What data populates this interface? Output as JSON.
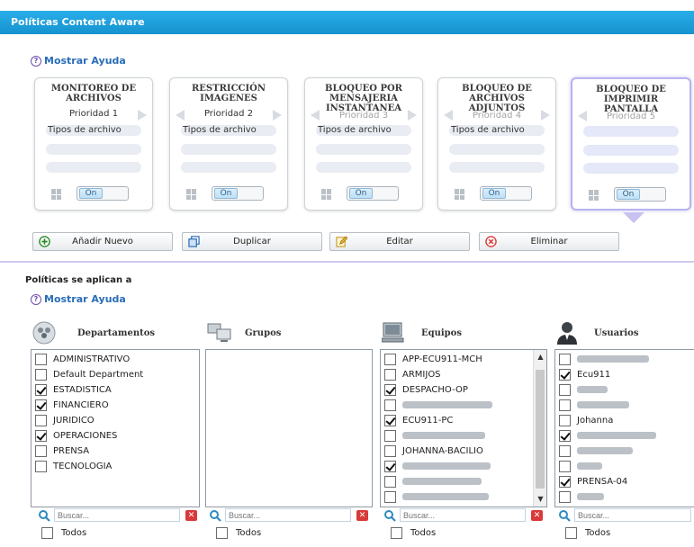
{
  "window": {
    "title": "Políticas Content Aware"
  },
  "help": {
    "label": "Mostrar Ayuda"
  },
  "cards": [
    {
      "title_lines": [
        "MONITOREO DE",
        "ARCHIVOS"
      ],
      "priority": "Prioridad 1",
      "file_types": "Tipos de archivo",
      "toggle": "On",
      "active": false
    },
    {
      "title_lines": [
        "RESTRICCIÓN",
        "IMAGENES"
      ],
      "priority": "Prioridad 2",
      "file_types": "Tipos de archivo",
      "toggle": "On",
      "active": false
    },
    {
      "title_lines": [
        "BLOQUEO POR",
        "MENSAJERIA",
        "INSTANTANEA"
      ],
      "priority": "Prioridad 3",
      "file_types": "Tipos de archivo",
      "toggle": "On",
      "active": false
    },
    {
      "title_lines": [
        "BLOQUEO DE",
        "ARCHIVOS",
        "ADJUNTOS"
      ],
      "priority": "Prioridad 4",
      "file_types": "Tipos de archivo",
      "toggle": "On",
      "active": false
    },
    {
      "title_lines": [
        "BLOQUEO DE",
        "IMPRIMIR",
        "PANTALLA"
      ],
      "priority": "Prioridad 5",
      "file_types": "",
      "toggle": "On",
      "active": true
    }
  ],
  "toolbar": {
    "add": "Añadir Nuevo",
    "duplicate": "Duplicar",
    "edit": "Editar",
    "delete": "Eliminar"
  },
  "applies": {
    "title": "Políticas se aplican a"
  },
  "columns": {
    "departamentos": {
      "label": "Departamentos",
      "items": [
        {
          "text": "ADMINISTRATIVO",
          "checked": false
        },
        {
          "text": "Default Department",
          "checked": false
        },
        {
          "text": "ESTADISTICA",
          "checked": true
        },
        {
          "text": "FINANCIERO",
          "checked": true
        },
        {
          "text": "JURIDICO",
          "checked": false
        },
        {
          "text": "OPERACIONES",
          "checked": true
        },
        {
          "text": "PRENSA",
          "checked": false
        },
        {
          "text": "TECNOLOGIA",
          "checked": false
        }
      ]
    },
    "grupos": {
      "label": "Grupos",
      "items": []
    },
    "equipos": {
      "label": "Equipos",
      "items": [
        {
          "text": "APP-ECU911-MCH",
          "checked": false,
          "redacted": false
        },
        {
          "text": "ARMIJOS",
          "checked": false,
          "redacted": false
        },
        {
          "text": "DESPACHO-OP",
          "checked": true,
          "redacted": false
        },
        {
          "text": "",
          "checked": false,
          "redacted": true
        },
        {
          "text": "ECU911-PC",
          "checked": true,
          "redacted": false
        },
        {
          "text": "",
          "checked": false,
          "redacted": true
        },
        {
          "text": "JOHANNA-BACILIO",
          "checked": false,
          "redacted": false
        },
        {
          "text": "",
          "checked": true,
          "redacted": true
        },
        {
          "text": "",
          "checked": false,
          "redacted": true
        },
        {
          "text": "",
          "checked": false,
          "redacted": true
        }
      ]
    },
    "usuarios": {
      "label": "Usuarios",
      "items": [
        {
          "text": "",
          "checked": false,
          "redacted": true
        },
        {
          "text": "Ecu911",
          "checked": true,
          "redacted": false
        },
        {
          "text": "",
          "checked": false,
          "redacted": true
        },
        {
          "text": "",
          "checked": false,
          "redacted": true
        },
        {
          "text": "Johanna",
          "checked": false,
          "redacted": false
        },
        {
          "text": "",
          "checked": true,
          "redacted": true
        },
        {
          "text": "",
          "checked": false,
          "redacted": true
        },
        {
          "text": "",
          "checked": false,
          "redacted": true
        },
        {
          "text": "PRENSA-04",
          "checked": true,
          "redacted": false
        },
        {
          "text": "",
          "checked": false,
          "redacted": true
        }
      ]
    }
  },
  "search": {
    "placeholder": "Buscar..."
  },
  "select_all": {
    "label": "Todos"
  },
  "colors": {
    "title_bar": "#1e9fdc",
    "link": "#2a6db8",
    "active_card_border": "#b8b2ee",
    "clear_button": "#d83a3a"
  }
}
